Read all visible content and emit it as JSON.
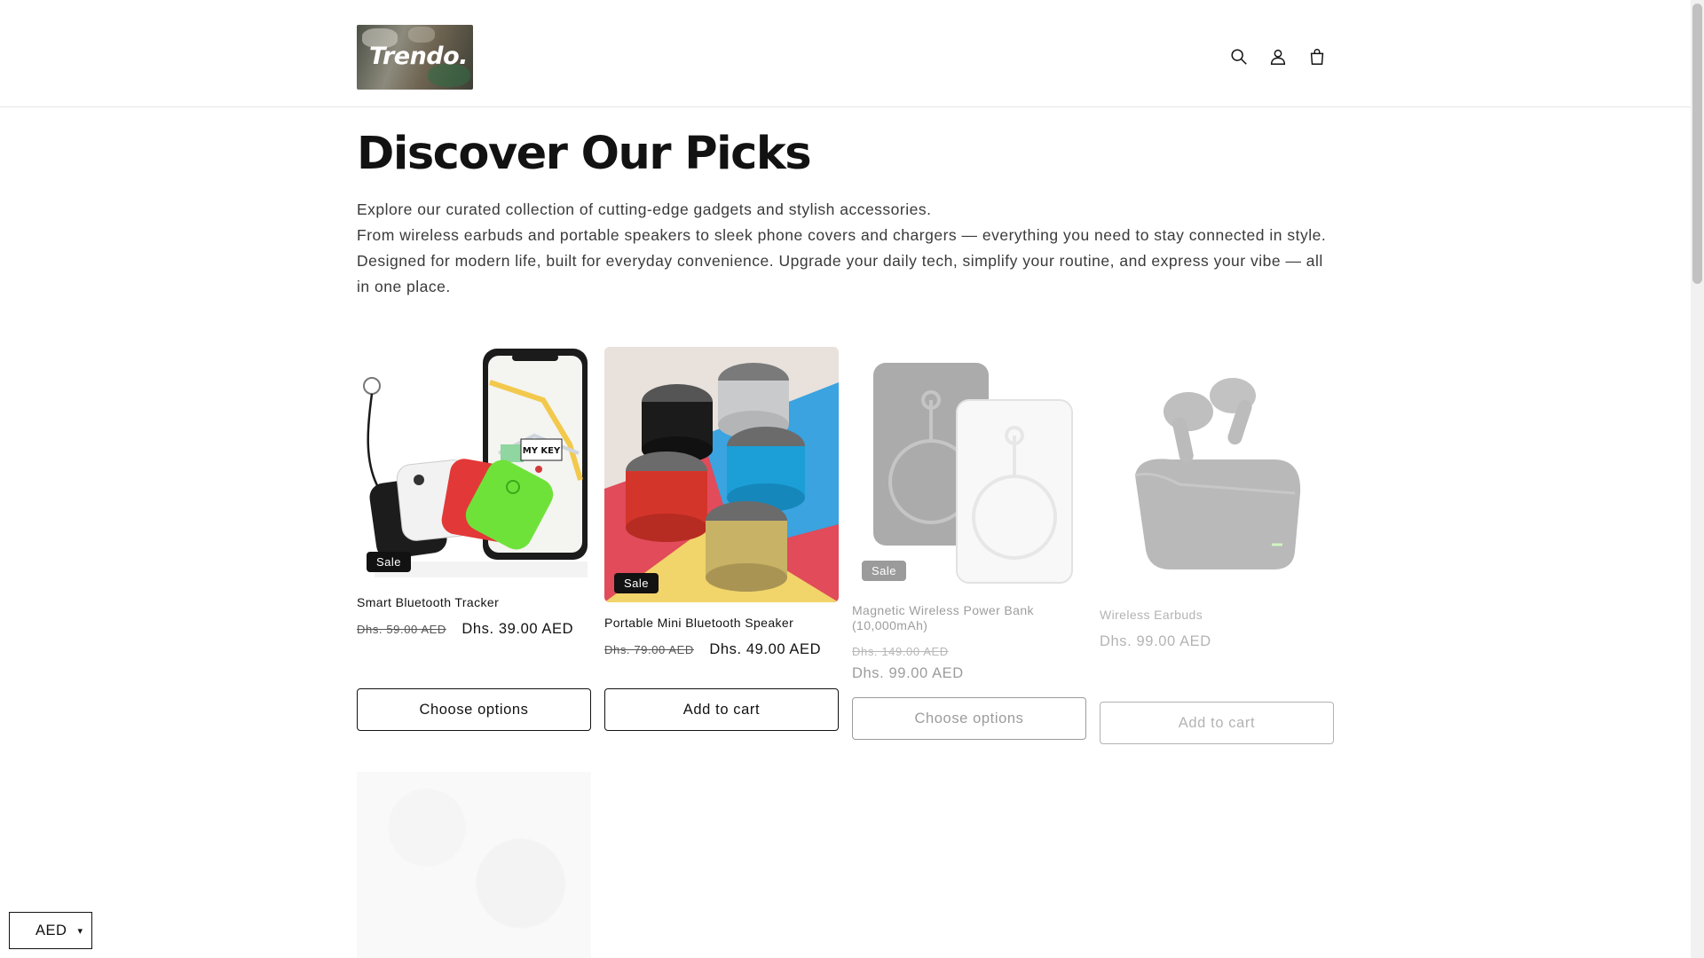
{
  "header": {
    "logo_text": "Trendo.",
    "icons": [
      "search-icon",
      "account-icon",
      "cart-icon"
    ]
  },
  "collection": {
    "title": "Discover Our Picks",
    "description_lines": [
      "Explore our curated collection of cutting-edge gadgets and stylish accessories.",
      "From wireless earbuds and portable speakers to sleek phone covers and chargers — everything you need to stay connected in style. Designed for modern life, built for everyday convenience. Upgrade your daily tech, simplify your routine, and express your vibe — all in one place."
    ]
  },
  "products": [
    {
      "name": "Smart Bluetooth Tracker",
      "badge": "Sale",
      "old_price": "Dhs. 59.00 AED",
      "price": "Dhs. 39.00 AED",
      "button": "Choose options"
    },
    {
      "name": "Portable Mini Bluetooth Speaker",
      "badge": "Sale",
      "old_price": "Dhs. 79.00 AED",
      "price": "Dhs. 49.00 AED",
      "button": "Add to cart"
    },
    {
      "name": "Magnetic Wireless Power Bank (10,000mAh)",
      "badge": "Sale",
      "old_price": "Dhs. 149.00 AED",
      "price": "Dhs. 99.00 AED",
      "button": "Choose options"
    },
    {
      "name": "Wireless Earbuds",
      "price": "Dhs. 99.00 AED",
      "button": "Add to cart"
    }
  ],
  "currency": {
    "code": "AED",
    "caret": "▾"
  },
  "colors": {
    "text": "#121212",
    "badge_bg": "#121212",
    "border": "#e6e6e6",
    "tracker_green": "#6fe23a",
    "speaker_red": "#d63a2a",
    "speaker_blue": "#1aa3d8",
    "speaker_gold": "#c9b36a"
  }
}
